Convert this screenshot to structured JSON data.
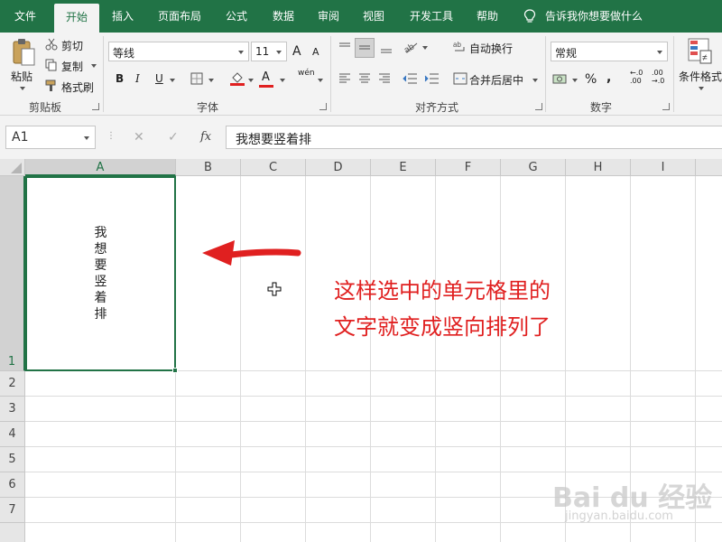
{
  "tabs": [
    "文件",
    "开始",
    "插入",
    "页面布局",
    "公式",
    "数据",
    "审阅",
    "视图",
    "开发工具",
    "帮助"
  ],
  "active_tab": "开始",
  "tell_me": "告诉我你想要做什么",
  "clipboard": {
    "paste": "粘贴",
    "cut": "剪切",
    "copy": "复制",
    "format_painter": "格式刷",
    "label": "剪贴板"
  },
  "font": {
    "name": "等线",
    "size": "11",
    "label": "字体",
    "bold": "B",
    "italic": "I",
    "underline": "U",
    "grow": "A",
    "shrink": "A",
    "font_color": "A",
    "phonetic": "wén"
  },
  "alignment": {
    "wrap_text": "自动换行",
    "merge_center": "合并后居中",
    "label": "对齐方式"
  },
  "number": {
    "format": "常规",
    "percent": "%",
    "comma": ",",
    "inc_decimal": "←.0 .00",
    "dec_decimal": ".00 →.0",
    "label": "数字"
  },
  "styles": {
    "conditional_formatting": "条件格式"
  },
  "formula_bar": {
    "name_box": "A1",
    "cancel": "✕",
    "enter": "✓",
    "fx": "fx",
    "content": "我想要竖着排"
  },
  "grid": {
    "columns": [
      "A",
      "B",
      "C",
      "D",
      "E",
      "F",
      "G",
      "H",
      "I"
    ],
    "rows": [
      "1",
      "2",
      "3",
      "4",
      "5",
      "6",
      "7"
    ],
    "selected_cell": "A1",
    "a1_vertical_text": [
      "我",
      "想",
      "要",
      "竖",
      "着",
      "排"
    ]
  },
  "annotation": {
    "line1": "这样选中的单元格里的",
    "line2": "文字就变成竖向排列了"
  },
  "colors": {
    "excel_green": "#217346",
    "annotation_red": "#e02020"
  },
  "watermark": {
    "brand": "Bai du 经验",
    "url": "jingyan.baidu.com"
  }
}
